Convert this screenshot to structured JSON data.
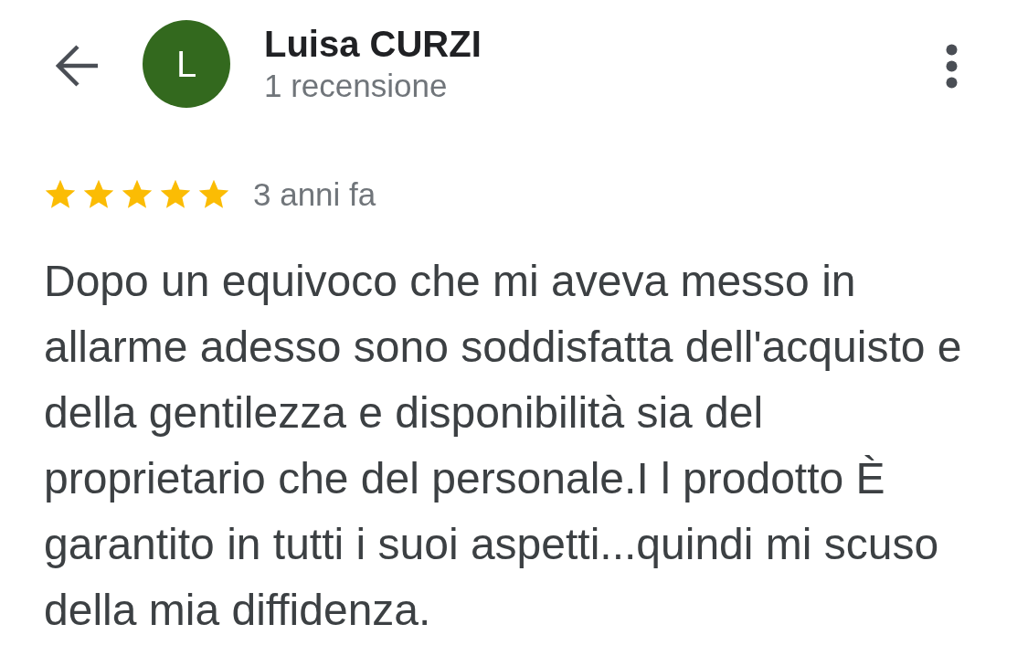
{
  "header": {
    "avatar_letter": "L",
    "name": "Luisa CURZI",
    "subtitle": "1 recensione"
  },
  "review": {
    "stars": 5,
    "time": "3 anni fa",
    "text": "Dopo un equivoco che mi aveva messo in allarme adesso sono soddisfatta dell'acquisto e della gentilezza e disponibilità sia del proprietario che del personale.I l prodotto È garantito in tutti i suoi aspetti...quindi mi scuso della mia diffidenza."
  }
}
